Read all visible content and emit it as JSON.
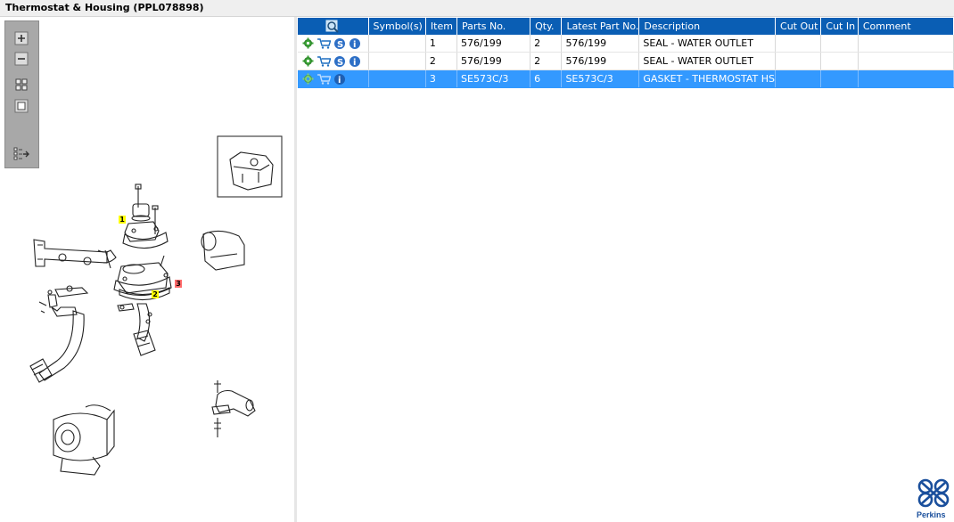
{
  "window": {
    "title": "Thermostat & Housing (PPL078898)"
  },
  "toolbar": {
    "buttons": [
      "zoom-in",
      "zoom-out",
      "fit-all",
      "fit-window",
      "export"
    ]
  },
  "diagram": {
    "callouts": [
      {
        "label": "1",
        "color": "#ffff00"
      },
      {
        "label": "2",
        "color": "#ffff00"
      },
      {
        "label": "3",
        "color": "#ff6b6b"
      }
    ]
  },
  "table": {
    "headers": [
      "Symbol(s)",
      "Item",
      "Parts No.",
      "Qty.",
      "Latest Part No.",
      "Description",
      "Cut Out",
      "Cut In",
      "Comment"
    ],
    "rows": [
      {
        "item": "1",
        "part_no": "576/199",
        "qty": "2",
        "latest": "576/199",
        "description": "SEAL - WATER OUTLET",
        "cut_out": "",
        "cut_in": "",
        "comment": "",
        "selected": false
      },
      {
        "item": "2",
        "part_no": "576/199",
        "qty": "2",
        "latest": "576/199",
        "description": "SEAL - WATER OUTLET",
        "cut_out": "",
        "cut_in": "",
        "comment": "",
        "selected": false
      },
      {
        "item": "3",
        "part_no": "SE573C/3",
        "qty": "6",
        "latest": "SE573C/3",
        "description": "GASKET - THERMOSTAT HS",
        "cut_out": "",
        "cut_in": "",
        "comment": "",
        "selected": true
      }
    ]
  },
  "brand": {
    "name": "Perkins",
    "color": "#1a4f9c"
  },
  "colors": {
    "header": "#0a5eb4",
    "selection": "#3399ff"
  }
}
